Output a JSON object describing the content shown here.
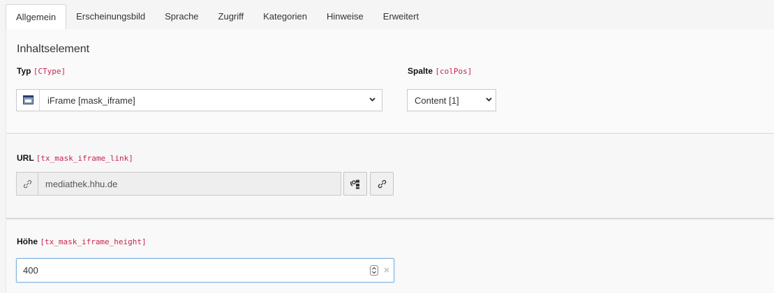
{
  "tabs": [
    {
      "label": "Allgemein",
      "active": true
    },
    {
      "label": "Erscheinungsbild"
    },
    {
      "label": "Sprache"
    },
    {
      "label": "Zugriff"
    },
    {
      "label": "Kategorien"
    },
    {
      "label": "Hinweise"
    },
    {
      "label": "Erweitert"
    }
  ],
  "content_element": {
    "title": "Inhaltselement",
    "type_field": {
      "label": "Typ",
      "code": "[CType]",
      "value": "iFrame [mask_iframe]",
      "icon": "window-icon"
    },
    "column_field": {
      "label": "Spalte",
      "code": "[colPos]",
      "value": "Content [1]"
    }
  },
  "url_field": {
    "label": "URL",
    "code": "[tx_mask_iframe_link]",
    "value": "mediathek.hhu.de",
    "icons": [
      "link-icon",
      "page-link-icon",
      "link-icon"
    ]
  },
  "height_field": {
    "label": "Höhe",
    "code": "[tx_mask_iframe_height]",
    "value": "400"
  },
  "colors": {
    "code": "#c7254e",
    "focus_border": "#7fb1e0",
    "active_tab_bg": "#ffffff"
  }
}
